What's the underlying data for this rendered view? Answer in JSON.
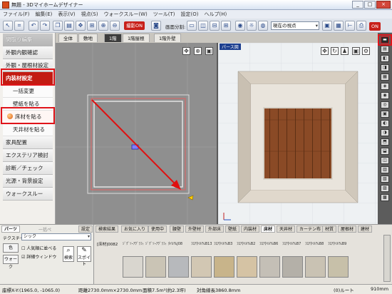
{
  "title": "無題 - 3Dマイホームデザイナー",
  "window_buttons": [
    "_",
    "□",
    "×"
  ],
  "menu": [
    "ファイル(F)",
    "編集(E)",
    "表示(V)",
    "視点(S)",
    "ウォークスルー(W)",
    "ツール(T)",
    "設定(O)",
    "ヘルプ(H)"
  ],
  "toolbar": {
    "camera_on": "撮影ON",
    "split_label": "画面分割:",
    "viewpoint": "視点",
    "viewpoint_select": "現在の視点",
    "on_label": "ON"
  },
  "left_menu": {
    "top": "間取り編集",
    "items": [
      "外観内観確認",
      "外観・屋根材設定"
    ],
    "interior": "内装材設定",
    "subs": [
      "一括変更",
      "壁紙を貼る",
      "床材を貼る",
      "天井材を貼る"
    ],
    "rest": [
      "家具配置",
      "エクステリア検討",
      "診断／チェック",
      "光源・背景設定",
      "ウォークスルー"
    ]
  },
  "floor_tabs": [
    "全体",
    "敷地",
    "1階",
    "1階屋根",
    "1階外壁"
  ],
  "active_floor_tab": "1階",
  "view3d_label": "パース図",
  "colors": {
    "accent_red": "#e0141a",
    "arrow_red": "#e01010"
  },
  "bottom": {
    "parts_tab": "パーツ",
    "check_label": "一括ペ",
    "settings": "設定",
    "texture_label": "テクスチャ",
    "texture_value": "シック",
    "color_btn": "色",
    "walk_btn": "ウォーク",
    "chk1": "人気順に並べる",
    "chk2": "詳細ウィンドウ",
    "search": "検索",
    "dropper": "スポイト",
    "cat_tabs": [
      "検索結果",
      "お気に入り",
      "使用中",
      "腰壁",
      "外壁材",
      "外部床",
      "壁紙",
      "内装材",
      "床材",
      "天井材",
      "カーテン布",
      "材質",
      "屋根材",
      "建材"
    ],
    "active_cat": "床材",
    "material_header": "[床材]0082",
    "swatches": [
      {
        "label": "ｼﾞｸﾞｿｰｱｸﾞﾗﾌｨﾄ%B1",
        "color": "#d9d6cf"
      },
      {
        "label": "ｼﾞｸﾞｿｰｱｸﾞﾗﾌｨﾄ%B2",
        "color": "#cac4b5"
      },
      {
        "label": "ﾀｲﾙ%J08",
        "color": "#b7b9bc"
      },
      {
        "label": "ﾌﾛｱﾀｲﾙ%B13",
        "color": "#d2c7b3"
      },
      {
        "label": "ﾌﾛｱﾀｲﾙ%B3",
        "color": "#c8b48a"
      },
      {
        "label": "ﾌﾛｱﾀｲﾙ%B2",
        "color": "#d5c3a4"
      },
      {
        "label": "ﾌﾛｱﾀｲﾙ%B6",
        "color": "#c4bfb6"
      },
      {
        "label": "ﾌﾛｱﾀｲﾙ%B7",
        "color": "#b4b0a8"
      },
      {
        "label": "ﾌﾛｱﾀｲﾙ%B8",
        "color": "#c9c2b3"
      },
      {
        "label": "ﾌﾛｱﾀｲﾙ%B9",
        "color": "#c7c0a9"
      }
    ]
  },
  "status": {
    "coords": "座標X-Y:(1965.0, -1065.0)",
    "dist": "距離2730.0mm×2730.0mm",
    "area": "面積7.5m²(約2.3坪)",
    "diag": "対角線長3860.8mm",
    "route": "(0)ルート",
    "scale": "910mm"
  }
}
